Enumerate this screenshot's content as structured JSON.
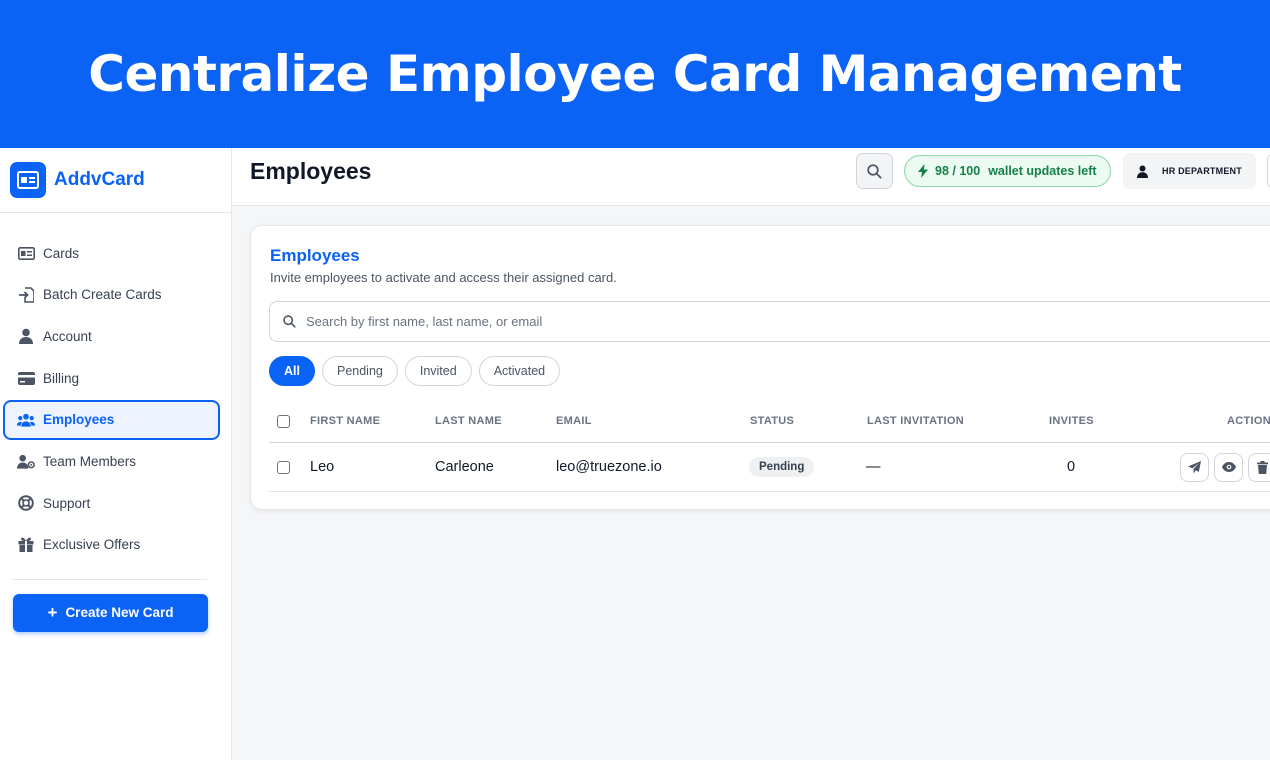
{
  "banner": {
    "title": "Centralize Employee Card Management"
  },
  "brand": {
    "name": "AddvCard",
    "icon": "id-card-icon"
  },
  "sidebar": {
    "items": [
      {
        "label": "Cards",
        "icon": "id-card-icon",
        "active": false
      },
      {
        "label": "Batch Create Cards",
        "icon": "file-import-icon",
        "active": false
      },
      {
        "label": "Account",
        "icon": "user-icon",
        "active": false
      },
      {
        "label": "Billing",
        "icon": "credit-card-icon",
        "active": false
      },
      {
        "label": "Employees",
        "icon": "users-icon",
        "active": true
      },
      {
        "label": "Team Members",
        "icon": "user-gear-icon",
        "active": false
      },
      {
        "label": "Support",
        "icon": "life-ring-icon",
        "active": false
      },
      {
        "label": "Exclusive Offers",
        "icon": "gift-icon",
        "active": false
      }
    ],
    "create_button": "Create New Card"
  },
  "topbar": {
    "title": "Employees",
    "wallet_count": "98 / 100",
    "wallet_label": "wallet updates left",
    "department": "HR DEPARTMENT"
  },
  "panel": {
    "title": "Employees",
    "subtitle": "Invite employees to activate and access their assigned card.",
    "search_placeholder": "Search by first name, last name, or email",
    "filters": [
      "All",
      "Pending",
      "Invited",
      "Activated"
    ],
    "active_filter": "All",
    "columns": [
      "FIRST NAME",
      "LAST NAME",
      "EMAIL",
      "STATUS",
      "LAST INVITATION",
      "INVITES",
      "ACTION"
    ],
    "rows": [
      {
        "first_name": "Leo",
        "last_name": "Carleone",
        "email": "leo@truezone.io",
        "status": "Pending",
        "last_invitation": "—",
        "invites": "0"
      }
    ]
  },
  "colors": {
    "brand": "#0b63f6",
    "success": "#16804a",
    "success_bg": "#ecfbf1"
  }
}
